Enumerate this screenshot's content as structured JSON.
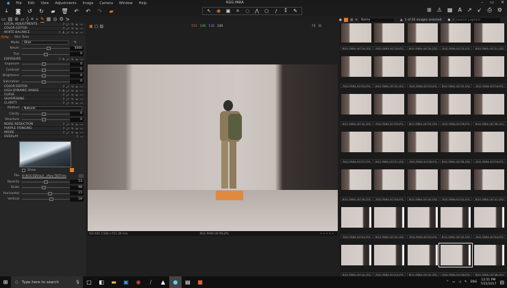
{
  "menubar": {
    "items": [
      "File",
      "Edit",
      "View",
      "Adjustments",
      "Image",
      "Camera",
      "Window",
      "Help"
    ],
    "title": "RGG PARA"
  },
  "left_panel": {
    "sections_top": [
      "LOCAL ADJUSTMENTS",
      "COLOR EDITOR",
      "WHITE BALANCE"
    ],
    "wb_tabs": [
      "Gray",
      "Skin Tone"
    ],
    "wb": {
      "mode_label": "Mode",
      "mode_value": "Shot",
      "kelvin_label": "Kelvin",
      "kelvin": "5000",
      "tint_label": "Tint",
      "tint": "0"
    },
    "exposure": {
      "title": "EXPOSURE",
      "rows": [
        {
          "label": "Exposure",
          "value": "0"
        },
        {
          "label": "Contrast",
          "value": "0"
        },
        {
          "label": "Brightness",
          "value": "0"
        },
        {
          "label": "Saturation",
          "value": "0"
        }
      ]
    },
    "sections_mid": [
      "COLOR EDITOR",
      "HIGH DYNAMIC RANGE",
      "CURVE",
      "SHARPENING",
      "CLARITY"
    ],
    "clarity": {
      "method_label": "Method",
      "method_value": "Natural",
      "rows": [
        {
          "label": "Clarity",
          "value": "0"
        },
        {
          "label": "Structure",
          "value": "0"
        }
      ]
    },
    "sections_low": [
      "NOISE REDUCTION",
      "PURPLE FRINGING",
      "MOIRE",
      "OVERLAY"
    ],
    "overlay": {
      "show_label": "Show",
      "file_label": "File",
      "file_value": "H:\\RGG EDU\\e2\\...\\Para TEST.tiro",
      "rows": [
        {
          "label": "Opacity",
          "value": "53",
          "pos": 0.5
        },
        {
          "label": "Scale",
          "value": "98",
          "pos": 0.45
        },
        {
          "label": "Horizontal",
          "value": "15",
          "pos": 0.6
        },
        {
          "label": "Vertical",
          "value": "18",
          "pos": 0.63
        }
      ]
    }
  },
  "viewer": {
    "readout": [
      "153",
      "146",
      "128",
      "140"
    ],
    "readout_colors": [
      "#e0704a",
      "#6ccf6c",
      "#7c8cf0",
      "#cccccc"
    ],
    "fit_label": "Fit",
    "exif": "ISO 400  1/160 s  f/11  40 mm",
    "filename": "RGG PARA 00746.JPG"
  },
  "browser": {
    "sort_value": "Name",
    "selected_info": "1 of 50 images selected",
    "search_placeholder": "Search Capture",
    "thumbnails": [
      "RGG PARA 00729.CR2",
      "RGG PARA 00730.JPG",
      "RGG PARA 00730.CR2",
      "RGG PARA 00731.JPG",
      "RGG PARA 00731.CR2",
      "RGG PARA 00732.JPG",
      "RGG PARA 00732.CR2",
      "RGG PARA 00733.JPG",
      "RGG PARA 00733.CR2",
      "RGG PARA 00734.JPG",
      "RGG PARA 00734.CR2",
      "RGG PARA 00735.JPG",
      "RGG PARA 00735.CR2",
      "RGG PARA 00736.JPG",
      "RGG PARA 00736.CR2",
      "RGG PARA 00737.JPG",
      "RGG PARA 00737.CR2",
      "RGG PARA 00738.JPG",
      "RGG PARA 00738.CR2",
      "RGG PARA 00739.JPG",
      "RGG PARA 00739.CR2",
      "RGG PARA 00740.JPG",
      "RGG PARA 00740.CR2",
      "RGG PARA 00741.JPG",
      "RGG PARA 00741.CR2",
      "RGG PARA 00742.JPG",
      "RGG PARA 00742.CR2",
      "RGG PARA 00743.JPG",
      "RGG PARA 00743.CR2",
      "RGG PARA 00744.JPG",
      "RGG PARA 00744.CR2",
      "RGG PARA 00745.JPG",
      "RGG PARA 00745.CR2",
      "RGG PARA 00746.JPG",
      "RGG PARA 00746.CR2"
    ],
    "selected_index": 33
  },
  "taskbar": {
    "search_placeholder": "Type here to search",
    "language": "ENG",
    "time": "12:51 PM",
    "date": "7/25/2017"
  },
  "accent": "#e07a2a"
}
